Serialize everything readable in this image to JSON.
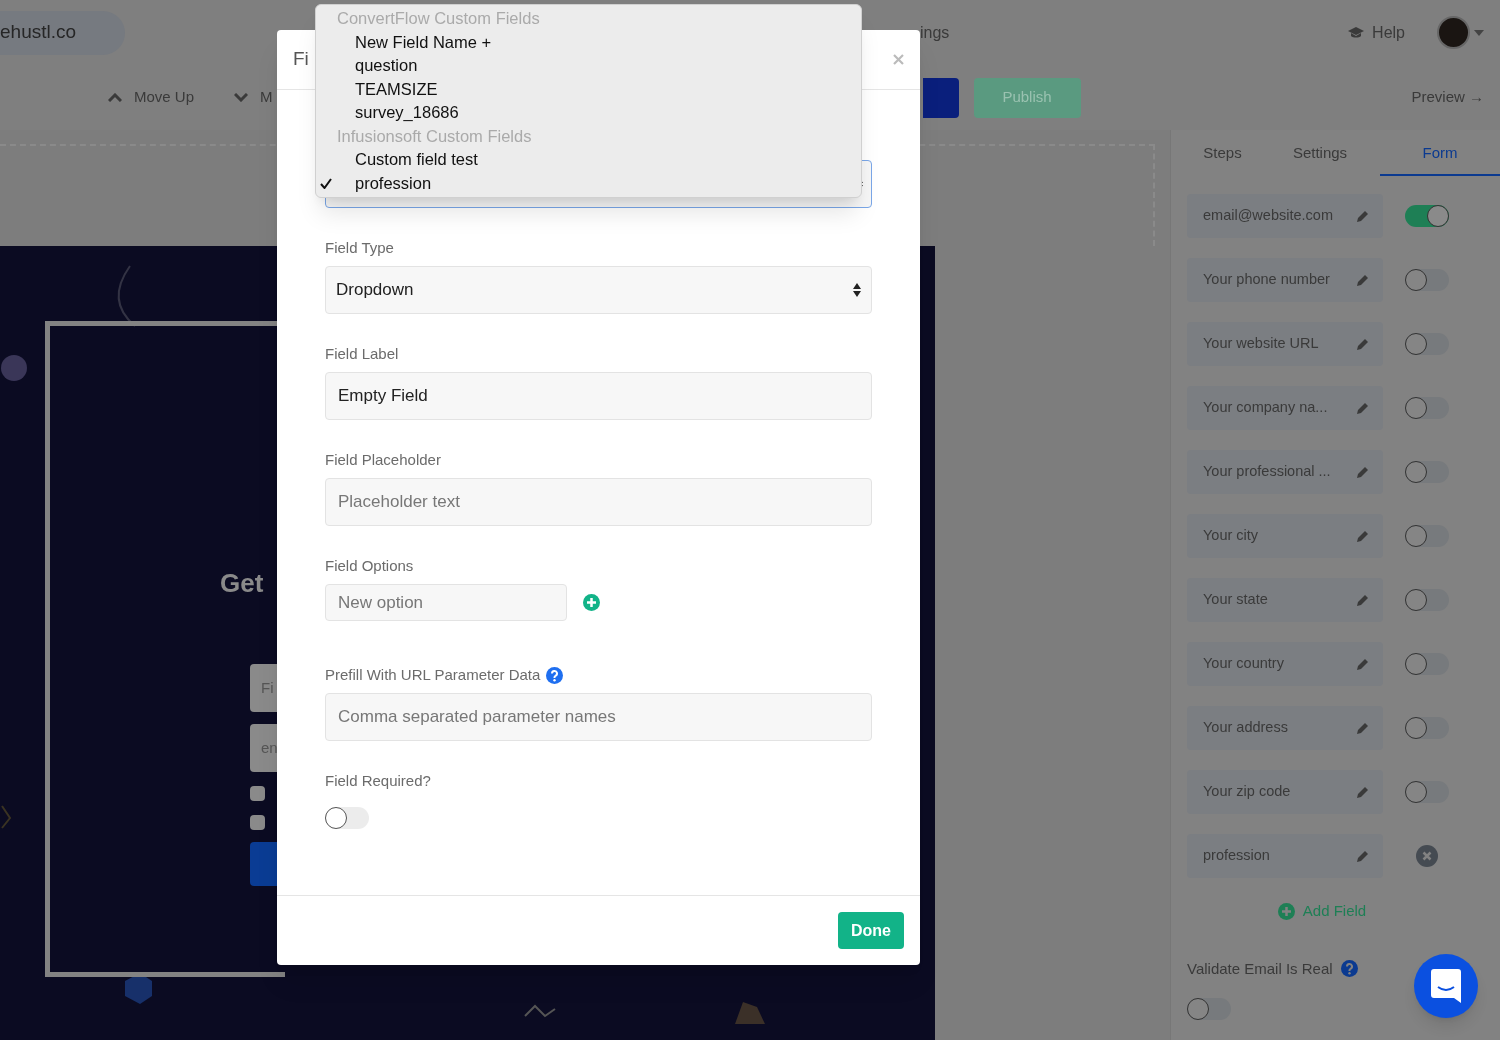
{
  "topbar": {
    "site": "ehustl.co",
    "nav_fragment": "ings",
    "help": "Help"
  },
  "toolbar": {
    "move_up": "Move Up",
    "move_down_fragment": "M",
    "publish": "Publish",
    "preview": "Preview →"
  },
  "preview": {
    "subheading_fragment": "Get",
    "inputs": [
      "Fi",
      "en"
    ],
    "checkboxes": [
      {
        "checked": false
      },
      {
        "checked": false
      }
    ]
  },
  "sidebar": {
    "tabs": [
      {
        "label": "Steps",
        "selected": false
      },
      {
        "label": "Settings",
        "selected": false
      },
      {
        "label": "Form",
        "selected": true
      }
    ],
    "fields": [
      {
        "label": "email@website.com",
        "kind": "toggle",
        "on": true
      },
      {
        "label": "Your phone number",
        "kind": "toggle",
        "on": false
      },
      {
        "label": "Your website URL",
        "kind": "toggle",
        "on": false
      },
      {
        "label": "Your company na...",
        "kind": "toggle",
        "on": false
      },
      {
        "label": "Your professional ...",
        "kind": "toggle",
        "on": false
      },
      {
        "label": "Your city",
        "kind": "toggle",
        "on": false
      },
      {
        "label": "Your state",
        "kind": "toggle",
        "on": false
      },
      {
        "label": "Your country",
        "kind": "toggle",
        "on": false
      },
      {
        "label": "Your address",
        "kind": "toggle",
        "on": false
      },
      {
        "label": "Your zip code",
        "kind": "toggle",
        "on": false
      },
      {
        "label": "profession",
        "kind": "removable"
      }
    ],
    "add_field": "Add Field",
    "validate": {
      "label": "Validate Email Is Real",
      "on": false
    }
  },
  "modal": {
    "title_fragment": "Fi",
    "dropdown": {
      "groups": [
        {
          "label": "ConvertFlow Custom Fields",
          "options": [
            {
              "label": "New Field Name +",
              "selected": false
            },
            {
              "label": "question",
              "selected": false
            },
            {
              "label": "TEAMSIZE",
              "selected": false
            },
            {
              "label": "survey_18686",
              "selected": false
            }
          ]
        },
        {
          "label": "Infusionsoft Custom Fields",
          "options": [
            {
              "label": "Custom field test",
              "selected": false
            },
            {
              "label": "profession",
              "selected": true
            }
          ]
        }
      ]
    },
    "fields": [
      {
        "kind": "select",
        "label": "Field Type",
        "value": "Dropdown"
      },
      {
        "kind": "text",
        "label": "Field Label",
        "value": "Empty Field"
      },
      {
        "kind": "text",
        "label": "Field Placeholder",
        "placeholder": "Placeholder text"
      },
      {
        "kind": "options",
        "label": "Field Options",
        "placeholder": "New option"
      },
      {
        "kind": "text",
        "label": "Prefill With URL Parameter Data",
        "help": true,
        "placeholder": "Comma separated parameter names"
      },
      {
        "kind": "toggle",
        "label": "Field Required?",
        "on": false
      }
    ],
    "done": "Done"
  }
}
